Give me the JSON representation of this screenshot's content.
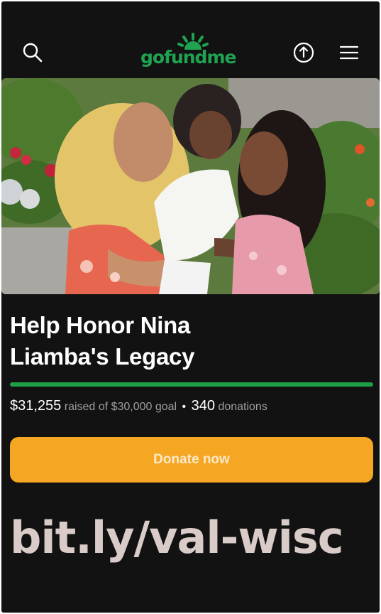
{
  "header": {
    "logo_text": "gofundme",
    "icons": [
      "search-icon",
      "share-icon",
      "menu-icon"
    ]
  },
  "campaign": {
    "title_line1": "Help Honor Nina",
    "title_line2": "Liamba's Legacy",
    "progress_fraction": 1.0,
    "raised_amount": "$31,255",
    "raised_text": "raised of $30,000 goal",
    "dot": "•",
    "donation_count": "340",
    "donations_label": "donations"
  },
  "donate": {
    "label": "Donate now"
  },
  "overlay": {
    "url_text": "bit.ly/val-wisc"
  },
  "colors": {
    "background": "#121212",
    "brand_green": "#1fa351",
    "progress_green": "#1ea047",
    "donate_orange": "#f5a623",
    "url_text": "#d9cbc8"
  }
}
